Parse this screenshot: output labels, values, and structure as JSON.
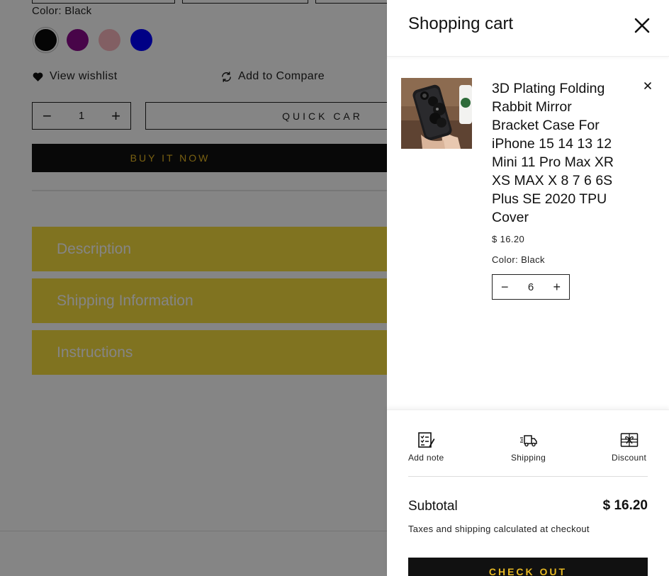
{
  "product": {
    "color_label": "Color:",
    "color_value": "Black",
    "swatches": [
      {
        "name": "Black",
        "color": "#0a0a0a"
      },
      {
        "name": "Purple",
        "color": "#8b0a8c"
      },
      {
        "name": "Pink",
        "color": "#f9b6bf"
      },
      {
        "name": "Blue",
        "color": "#0000ff"
      }
    ],
    "wishlist_label": "View wishlist",
    "compare_label": "Add to Compare",
    "quantity": "1",
    "quick_cart_label": "QUICK CAR",
    "buy_now_label": "BUY IT NOW",
    "accordions": [
      "Description",
      "Shipping Information",
      "Instructions"
    ]
  },
  "cart": {
    "title": "Shopping cart",
    "item": {
      "name": "3D Plating Folding Rabbit Mirror Bracket Case For iPhone 15 14 13 12 Mini 11 Pro Max XR XS MAX X 8 7 6 6S Plus SE 2020 TPU Cover",
      "price": "$ 16.20",
      "variant": "Color: Black",
      "quantity": "6"
    },
    "tools": {
      "note": "Add note",
      "shipping": "Shipping",
      "discount": "Discount"
    },
    "subtotal_label": "Subtotal",
    "subtotal_value": "$ 16.20",
    "tax_note": "Taxes and shipping calculated at checkout",
    "checkout_label": "CHECK OUT"
  },
  "colors": {
    "accent": "#e8b923",
    "accordion": "#f6dc3f",
    "button_dark": "#111111",
    "overlay": "rgba(0,0,0,0.48)"
  }
}
